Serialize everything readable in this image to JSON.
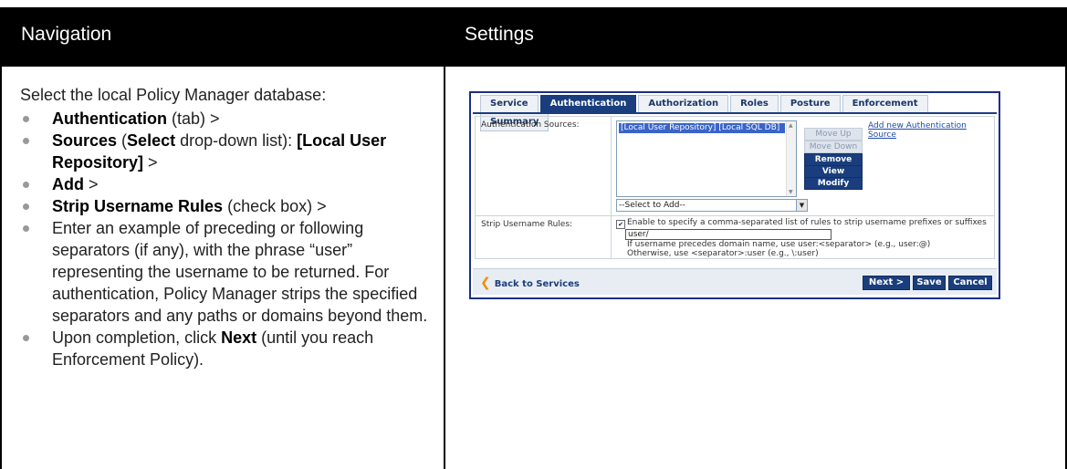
{
  "header": {
    "col1": "Navigation",
    "col2": "Settings"
  },
  "navigation": {
    "intro": "Select the local Policy Manager database:",
    "items": [
      {
        "b1": "Authentication",
        "t1": " (tab) >"
      },
      {
        "b1": "Sources",
        "t1": " (",
        "b2": "Select",
        "t2": " drop-down list): ",
        "b3": "[Local User Repository]",
        "t3": " >"
      },
      {
        "b1": "Add",
        "t1": " >"
      },
      {
        "b1": "Strip Username Rules",
        "t1": " (check box) >"
      },
      {
        "t1": "Enter an example of preceding or following separators (if any), with the phrase “user” representing the username to be returned. For authentication, Policy Manager strips the specified separators and any paths or domains beyond them."
      },
      {
        "t1": "Upon completion, click ",
        "b1": "Next",
        "t2": " (until you reach Enforcement Policy)."
      }
    ]
  },
  "screenshot": {
    "tabs": [
      "Service",
      "Authentication",
      "Authorization",
      "Roles",
      "Posture",
      "Enforcement",
      "Summary"
    ],
    "active_tab": "Authentication",
    "auth_sources_label": "Authentication Sources:",
    "selected_source": "[Local User Repository] [Local SQL DB]",
    "buttons": {
      "move_up": "Move Up",
      "move_down": "Move Down",
      "remove": "Remove",
      "view_details": "View Details",
      "modify": "Modify"
    },
    "add_link": "Add new Authentication Source",
    "select_placeholder": "--Select to Add--",
    "strip_label": "Strip Username Rules:",
    "strip_check_text": "Enable to specify a comma-separated list of rules to strip username prefixes or suffixes",
    "strip_value": "user/",
    "hint1": "If username precedes domain name, use user:<separator> (e.g., user:@)",
    "hint2": "Otherwise, use <separator>:user (e.g., \\:user)",
    "back_link": "Back to Services",
    "footer_buttons": {
      "next": "Next >",
      "save": "Save",
      "cancel": "Cancel"
    },
    "colors": {
      "accent": "#1a3e7d",
      "border": "#1b2f86",
      "back_chevron": "#f09000"
    }
  }
}
